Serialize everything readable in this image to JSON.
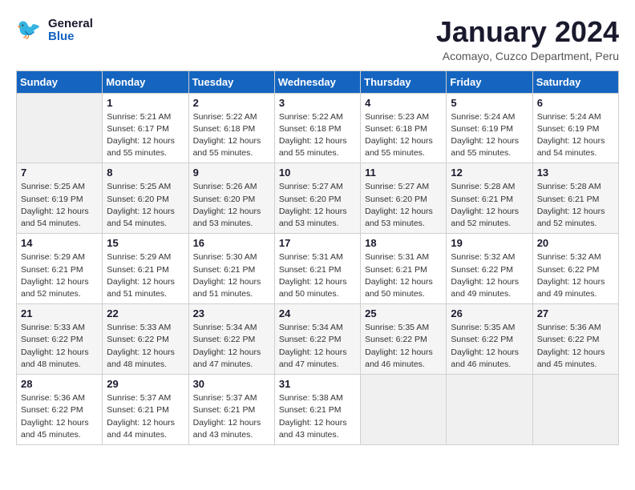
{
  "header": {
    "logo_text_general": "General",
    "logo_text_blue": "Blue",
    "month_title": "January 2024",
    "subtitle": "Acomayo, Cuzco Department, Peru"
  },
  "calendar": {
    "days_of_week": [
      "Sunday",
      "Monday",
      "Tuesday",
      "Wednesday",
      "Thursday",
      "Friday",
      "Saturday"
    ],
    "weeks": [
      [
        {
          "day": "",
          "empty": true
        },
        {
          "day": "1",
          "sunrise": "5:21 AM",
          "sunset": "6:17 PM",
          "daylight": "12 hours and 55 minutes."
        },
        {
          "day": "2",
          "sunrise": "5:22 AM",
          "sunset": "6:18 PM",
          "daylight": "12 hours and 55 minutes."
        },
        {
          "day": "3",
          "sunrise": "5:22 AM",
          "sunset": "6:18 PM",
          "daylight": "12 hours and 55 minutes."
        },
        {
          "day": "4",
          "sunrise": "5:23 AM",
          "sunset": "6:18 PM",
          "daylight": "12 hours and 55 minutes."
        },
        {
          "day": "5",
          "sunrise": "5:24 AM",
          "sunset": "6:19 PM",
          "daylight": "12 hours and 55 minutes."
        },
        {
          "day": "6",
          "sunrise": "5:24 AM",
          "sunset": "6:19 PM",
          "daylight": "12 hours and 54 minutes."
        }
      ],
      [
        {
          "day": "7",
          "sunrise": "5:25 AM",
          "sunset": "6:19 PM",
          "daylight": "12 hours and 54 minutes."
        },
        {
          "day": "8",
          "sunrise": "5:25 AM",
          "sunset": "6:20 PM",
          "daylight": "12 hours and 54 minutes."
        },
        {
          "day": "9",
          "sunrise": "5:26 AM",
          "sunset": "6:20 PM",
          "daylight": "12 hours and 53 minutes."
        },
        {
          "day": "10",
          "sunrise": "5:27 AM",
          "sunset": "6:20 PM",
          "daylight": "12 hours and 53 minutes."
        },
        {
          "day": "11",
          "sunrise": "5:27 AM",
          "sunset": "6:20 PM",
          "daylight": "12 hours and 53 minutes."
        },
        {
          "day": "12",
          "sunrise": "5:28 AM",
          "sunset": "6:21 PM",
          "daylight": "12 hours and 52 minutes."
        },
        {
          "day": "13",
          "sunrise": "5:28 AM",
          "sunset": "6:21 PM",
          "daylight": "12 hours and 52 minutes."
        }
      ],
      [
        {
          "day": "14",
          "sunrise": "5:29 AM",
          "sunset": "6:21 PM",
          "daylight": "12 hours and 52 minutes."
        },
        {
          "day": "15",
          "sunrise": "5:29 AM",
          "sunset": "6:21 PM",
          "daylight": "12 hours and 51 minutes."
        },
        {
          "day": "16",
          "sunrise": "5:30 AM",
          "sunset": "6:21 PM",
          "daylight": "12 hours and 51 minutes."
        },
        {
          "day": "17",
          "sunrise": "5:31 AM",
          "sunset": "6:21 PM",
          "daylight": "12 hours and 50 minutes."
        },
        {
          "day": "18",
          "sunrise": "5:31 AM",
          "sunset": "6:21 PM",
          "daylight": "12 hours and 50 minutes."
        },
        {
          "day": "19",
          "sunrise": "5:32 AM",
          "sunset": "6:22 PM",
          "daylight": "12 hours and 49 minutes."
        },
        {
          "day": "20",
          "sunrise": "5:32 AM",
          "sunset": "6:22 PM",
          "daylight": "12 hours and 49 minutes."
        }
      ],
      [
        {
          "day": "21",
          "sunrise": "5:33 AM",
          "sunset": "6:22 PM",
          "daylight": "12 hours and 48 minutes."
        },
        {
          "day": "22",
          "sunrise": "5:33 AM",
          "sunset": "6:22 PM",
          "daylight": "12 hours and 48 minutes."
        },
        {
          "day": "23",
          "sunrise": "5:34 AM",
          "sunset": "6:22 PM",
          "daylight": "12 hours and 47 minutes."
        },
        {
          "day": "24",
          "sunrise": "5:34 AM",
          "sunset": "6:22 PM",
          "daylight": "12 hours and 47 minutes."
        },
        {
          "day": "25",
          "sunrise": "5:35 AM",
          "sunset": "6:22 PM",
          "daylight": "12 hours and 46 minutes."
        },
        {
          "day": "26",
          "sunrise": "5:35 AM",
          "sunset": "6:22 PM",
          "daylight": "12 hours and 46 minutes."
        },
        {
          "day": "27",
          "sunrise": "5:36 AM",
          "sunset": "6:22 PM",
          "daylight": "12 hours and 45 minutes."
        }
      ],
      [
        {
          "day": "28",
          "sunrise": "5:36 AM",
          "sunset": "6:22 PM",
          "daylight": "12 hours and 45 minutes."
        },
        {
          "day": "29",
          "sunrise": "5:37 AM",
          "sunset": "6:21 PM",
          "daylight": "12 hours and 44 minutes."
        },
        {
          "day": "30",
          "sunrise": "5:37 AM",
          "sunset": "6:21 PM",
          "daylight": "12 hours and 43 minutes."
        },
        {
          "day": "31",
          "sunrise": "5:38 AM",
          "sunset": "6:21 PM",
          "daylight": "12 hours and 43 minutes."
        },
        {
          "day": "",
          "empty": true
        },
        {
          "day": "",
          "empty": true
        },
        {
          "day": "",
          "empty": true
        }
      ]
    ]
  }
}
